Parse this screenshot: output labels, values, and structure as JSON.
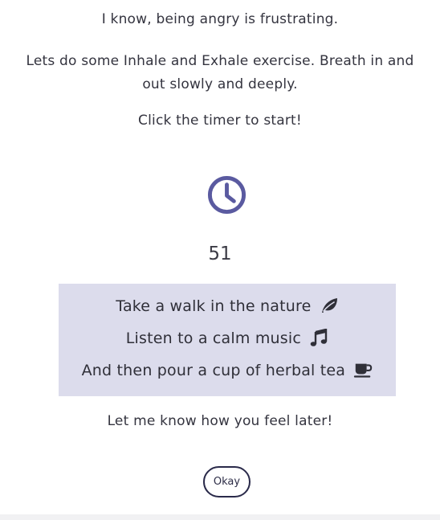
{
  "messages": {
    "line1": "I know, being angry is frustrating.",
    "line2": "Lets do some Inhale and Exhale exercise. Breath in and out slowly and deeply.",
    "line3": "Click the timer to start!",
    "line4": "Let me know how you feel later!"
  },
  "timer": {
    "icon": "clock-icon",
    "icon_color": "#5a5aa0",
    "count": "51"
  },
  "tips": [
    {
      "text": "Take a walk in the nature",
      "icon": "leaf-icon"
    },
    {
      "text": "Listen to a calm music",
      "icon": "music-note-icon"
    },
    {
      "text": "And then pour a cup of herbal tea",
      "icon": "coffee-cup-icon"
    }
  ],
  "tips_box_color": "#dcdcec",
  "button": {
    "label": "Okay"
  }
}
